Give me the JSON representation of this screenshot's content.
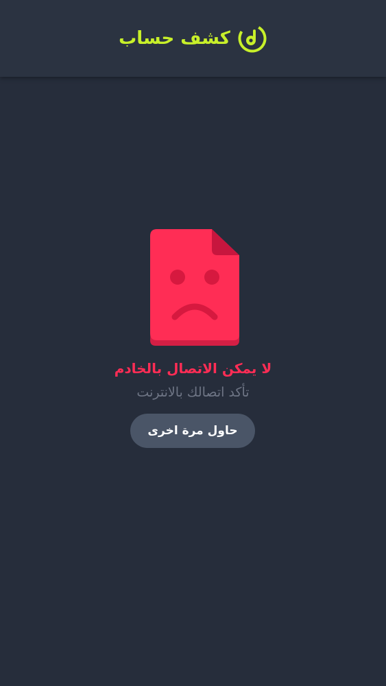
{
  "header": {
    "title": "كشف حساب",
    "logo_icon": "brand-logo-icon",
    "accent_color": "#c8f02a"
  },
  "error": {
    "icon": "sad-document-icon",
    "title": "لا يمكن الاتصال بالخادم",
    "subtitle": "تأكد اتصالك بالانترنت",
    "retry_label": "حاول مرة اخرى",
    "error_color": "#ff2d55"
  }
}
